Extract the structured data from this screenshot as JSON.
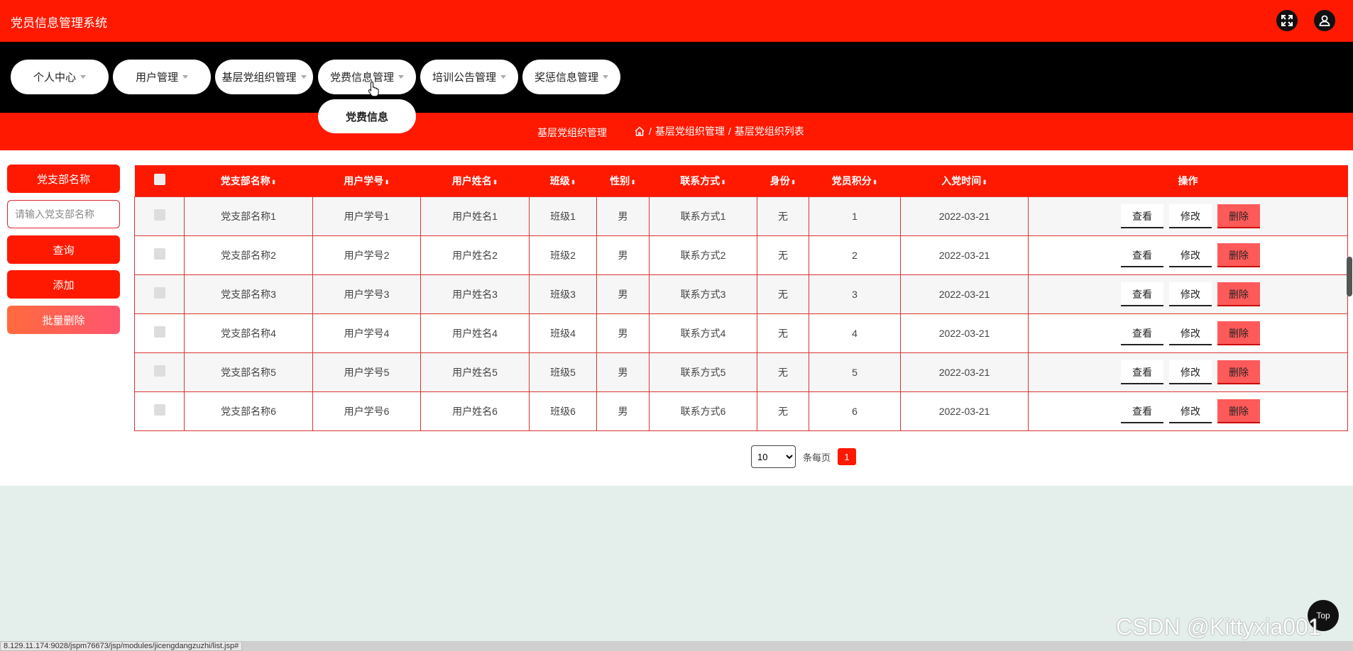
{
  "app": {
    "title": "党员信息管理系统"
  },
  "nav": [
    {
      "label": "个人中心"
    },
    {
      "label": "用户管理"
    },
    {
      "label": "基层党组织管理"
    },
    {
      "label": "党费信息管理"
    },
    {
      "label": "培训公告管理"
    },
    {
      "label": "奖惩信息管理"
    }
  ],
  "dropdown": {
    "item": "党费信息"
  },
  "breadcrumb": {
    "title": "基层党组织管理",
    "path1": "基层党组织管理",
    "separator": "/",
    "path2": "基层党组织列表"
  },
  "sidebar": {
    "label": "党支部名称",
    "placeholder": "请输入党支部名称",
    "search": "查询",
    "add": "添加",
    "batch_delete": "批量删除",
    "colors": {
      "primary": "#ff1900",
      "gradient": "#ff6f61"
    }
  },
  "table": {
    "headers": [
      "党支部名称",
      "用户学号",
      "用户姓名",
      "班级",
      "性别",
      "联系方式",
      "身份",
      "党员积分",
      "入党时间",
      "操作"
    ],
    "sort_glyph": "⬍",
    "rows": [
      [
        "党支部名称1",
        "用户学号1",
        "用户姓名1",
        "班级1",
        "男",
        "联系方式1",
        "无",
        "1",
        "2022-03-21"
      ],
      [
        "党支部名称2",
        "用户学号2",
        "用户姓名2",
        "班级2",
        "男",
        "联系方式2",
        "无",
        "2",
        "2022-03-21"
      ],
      [
        "党支部名称3",
        "用户学号3",
        "用户姓名3",
        "班级3",
        "男",
        "联系方式3",
        "无",
        "3",
        "2022-03-21"
      ],
      [
        "党支部名称4",
        "用户学号4",
        "用户姓名4",
        "班级4",
        "男",
        "联系方式4",
        "无",
        "4",
        "2022-03-21"
      ],
      [
        "党支部名称5",
        "用户学号5",
        "用户姓名5",
        "班级5",
        "男",
        "联系方式5",
        "无",
        "5",
        "2022-03-21"
      ],
      [
        "党支部名称6",
        "用户学号6",
        "用户姓名6",
        "班级6",
        "男",
        "联系方式6",
        "无",
        "6",
        "2022-03-21"
      ]
    ],
    "actions": {
      "view": "查看",
      "edit": "修改",
      "delete": "删除"
    }
  },
  "pagination": {
    "page_size": "10",
    "per_page_label": "条每页",
    "current_page": "1"
  },
  "top_button": "Top",
  "watermark": "CSDN @Kittyxia001",
  "status_url": "8.129.11.174:9028/jspm76673/jsp/modules/jicengdangzuzhi/list.jsp#"
}
